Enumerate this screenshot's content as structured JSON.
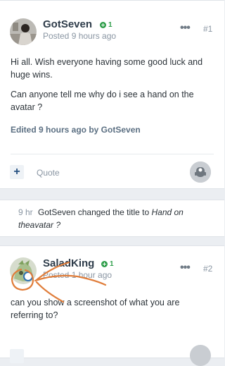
{
  "post1": {
    "username": "GotSeven",
    "reputation": "1",
    "posted": "Posted 9 hours ago",
    "post_number": "#1",
    "body": [
      "Hi all. Wish everyone having some good luck and huge wins.",
      "Can anyone tell me why do i see a hand on the avatar ?"
    ],
    "edited": "Edited 9 hours ago by GotSeven",
    "actions": {
      "add": "+",
      "quote": "Quote"
    },
    "menu_icon": "ellipsis-icon",
    "reaction_icon": "reaction-robot-icon"
  },
  "event": {
    "time": "9 hr",
    "text": "GotSeven changed the title to",
    "new_title": "Hand on theavatar ?"
  },
  "post2": {
    "username": "SaladKing",
    "reputation": "1",
    "posted": "Posted 1 hour ago",
    "post_number": "#2",
    "body": [
      "can you show a screenshot of what you are referring to?"
    ],
    "menu_icon": "ellipsis-icon",
    "annotation_color": "#e07d3a"
  },
  "colors": {
    "background": "#ebeef2",
    "card": "#ffffff",
    "reputation_green": "#2f9e4a",
    "link_blue": "#244f80",
    "annotation_orange": "#e07d3a"
  }
}
